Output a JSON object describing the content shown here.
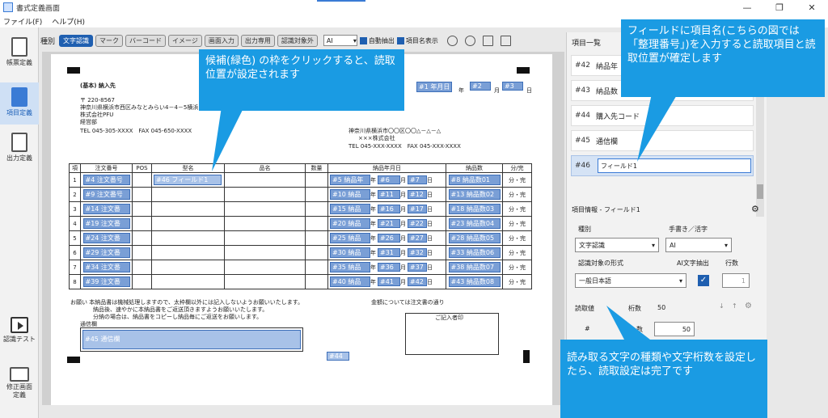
{
  "window": {
    "title": "書式定義画面",
    "min": "—",
    "max": "❐",
    "close": "✕"
  },
  "menu": [
    "ファイル(F)",
    "ヘルプ(H)"
  ],
  "nav": {
    "items": [
      {
        "label": "帳票定義",
        "icon": "document-icon"
      },
      {
        "label": "項目定義",
        "icon": "field-list-icon"
      },
      {
        "label": "出力定義",
        "icon": "output-icon"
      },
      {
        "label": "認識テスト",
        "icon": "play-icon"
      },
      {
        "label": "修正画面定義",
        "icon": "screen-icon"
      }
    ]
  },
  "toolbar": {
    "kind_label": "種別",
    "chips": [
      "文字認識",
      "マーク",
      "バーコード",
      "イメージ",
      "画面入力",
      "出力専用",
      "認識対象外"
    ],
    "engine_value": "AI",
    "auto_extract": "自動抽出",
    "show_name": "項目名表示"
  },
  "doc": {
    "customer_heading": "(基本) 納入先",
    "addr": [
      "〒 220-8567",
      "神奈川県横浜市西区みなとみらい4－4－5横浜",
      "株式会社PFU",
      "経営部",
      "TEL 045-305-XXXX　FAX 045-650-XXXX"
    ],
    "sender": [
      "神奈川県横浜市〇〇区〇〇△－△－△",
      "×××株式会社",
      "TEL 045-XXX-XXXX　FAX 045-XXX-XXXX"
    ],
    "date_fields": [
      "#1 年月日",
      "#2",
      "#3"
    ],
    "date_units": [
      "年",
      "月",
      "日"
    ],
    "headers": [
      "項",
      "注文番号",
      "POS",
      "型名",
      "品名",
      "数量",
      "納品年月日",
      "納品数",
      "分/完"
    ],
    "rows": [
      {
        "no": "1",
        "order": "#4 注文番号",
        "model": "#46 フィールド1",
        "date": [
          "#5 納品年",
          "#6",
          "#7"
        ],
        "qty": "#8 納品数01",
        "status": "分・完"
      },
      {
        "no": "2",
        "order": "#9 注文番号",
        "date": [
          "#10 納品",
          "#11",
          "#12"
        ],
        "qty": "#13 納品数02",
        "status": "分・完"
      },
      {
        "no": "3",
        "order": "#14 注文番",
        "date": [
          "#15 納品",
          "#16",
          "#17"
        ],
        "qty": "#18 納品数03",
        "status": "分・完"
      },
      {
        "no": "4",
        "order": "#19 注文番",
        "date": [
          "#20 納品",
          "#21",
          "#22"
        ],
        "qty": "#23 納品数04",
        "status": "分・完"
      },
      {
        "no": "5",
        "order": "#24 注文番",
        "date": [
          "#25 納品",
          "#26",
          "#27"
        ],
        "qty": "#28 納品数05",
        "status": "分・完"
      },
      {
        "no": "6",
        "order": "#29 注文番",
        "date": [
          "#30 納品",
          "#31",
          "#32"
        ],
        "qty": "#33 納品数06",
        "status": "分・完"
      },
      {
        "no": "7",
        "order": "#34 注文番",
        "date": [
          "#35 納品",
          "#36",
          "#37"
        ],
        "qty": "#38 納品数07",
        "status": "分・完"
      },
      {
        "no": "8",
        "order": "#39 注文番",
        "date": [
          "#40 納品",
          "#41",
          "#42"
        ],
        "qty": "#43 納品数08",
        "status": "分・完"
      }
    ],
    "notes": [
      "お願い 本納品書は機械処理しますので、太枠欄以外には記入しないようお願いいたします。",
      "納品後、速やかに本納品書をご返送頂きますようお願いいたします。",
      "分納の場合は、納品書をコピーし納品毎にご返送をお願いします。"
    ],
    "order_note": "金額については注文書の通り",
    "comm_label": "通信欄",
    "comm_field": "#45 通信欄",
    "stamp_label": "ご記入者印",
    "field44": "#44"
  },
  "panel": {
    "list_title": "項目一覧",
    "items": [
      {
        "no": "#42",
        "name": "納品年"
      },
      {
        "no": "#43",
        "name": "納品数"
      },
      {
        "no": "#44",
        "name": "購入先コード"
      },
      {
        "no": "#45",
        "name": "通信欄"
      },
      {
        "no": "#46",
        "name": "フィールド1"
      }
    ],
    "info_title": "項目情報 - フィールド1",
    "kind_label": "種別",
    "kind_value": "文字認識",
    "hand_label": "手書き／活字",
    "hand_value": "AI",
    "format_label": "認識対象の形式",
    "format_value": "一般日本語",
    "ai_label": "AI文字抽出",
    "lines_label": "行数",
    "lines_value": "1",
    "read_label": "読取値",
    "digits_label": "桁数",
    "digits_value": "50",
    "digits_row_prefix": "#",
    "digits_row_label": "数",
    "digits_input": "50"
  },
  "callouts": {
    "top_left": "候補(緑色) の枠をクリックすると、読取位置が設定されます",
    "top_right": "フィールドに項目名(こちらの図では「整理番号」)を入力すると読取項目と読取位置が確定します",
    "bottom_right": "読み取る文字の種類や文字桁数を設定したら、読取設定は完了です"
  }
}
